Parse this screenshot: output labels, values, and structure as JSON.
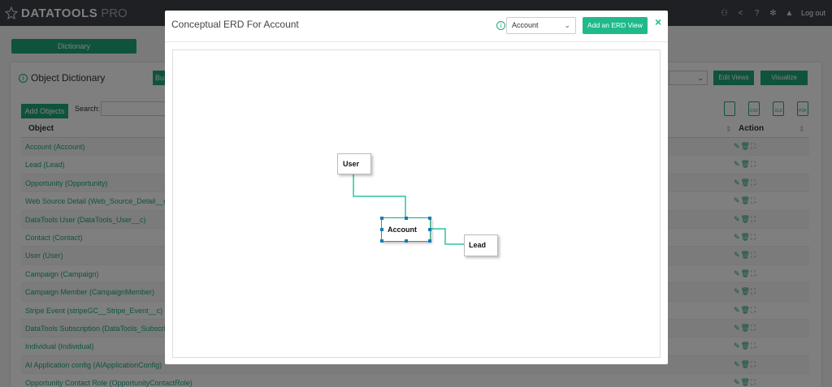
{
  "app": {
    "logo_main": "DATATOOLS",
    "logo_sub": "PRO",
    "logout": "Log out"
  },
  "top_icons": [
    "users-icon",
    "share-icon",
    "help-icon",
    "gear-icon",
    "bell-icon"
  ],
  "background": {
    "dictionary_button": "Dictionary",
    "object_dictionary_title": "Object Dictionary",
    "bu_button": "Bu",
    "edit_views": "Edit Views",
    "visualize": "Visualize",
    "add_objects": "Add Objects",
    "search_label": "Search:",
    "export_icons": [
      "clipboard-icon",
      "csv-icon",
      "xls-icon",
      "pdf-icon"
    ],
    "export_labels": [
      "",
      "CSV",
      "XLS",
      "PDF"
    ],
    "columns": {
      "object": "Object",
      "action": "Action"
    },
    "rows": [
      "Account (Account)",
      "Lead (Lead)",
      "Opportunity (Opportunity)",
      "Web Source Detail (Web_Source_Detail__c)",
      "DataTools User (DataTools_User__c)",
      "Contact (Contact)",
      "User (User)",
      "Campaign (Campaign)",
      "Campaign Member (CampaignMember)",
      "Stripe Event (stripeGC__Stripe_Event__c)",
      "DataTools Subscription (DataTools_Subscript",
      "Individual (Individual)",
      "AI Application config (AIApplicationConfig)",
      "Opportunity Contact Role (OpportunityContactRole)"
    ],
    "row_action": "✎🗑⛶"
  },
  "modal": {
    "title": "Conceptual ERD For Account",
    "select_value": "Account",
    "add_button": "Add an ERD View",
    "close": "×"
  },
  "erd": {
    "nodes": [
      "User",
      "Account",
      "Lead"
    ],
    "selected": "Account"
  },
  "colors": {
    "accent": "#1fa67a",
    "accent_light": "#1fba8c",
    "topbar": "#3d4047",
    "handle": "#1a7bb5"
  }
}
